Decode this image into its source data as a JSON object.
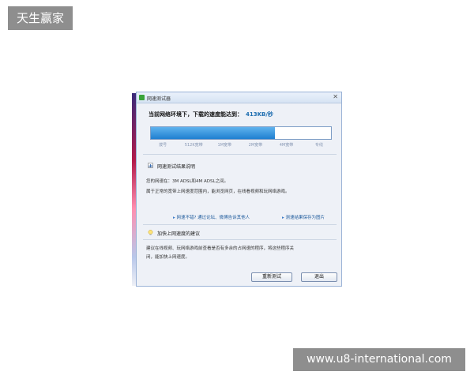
{
  "watermarks": {
    "top_left": "天生赢家",
    "bottom_right": "www.u8-international.com"
  },
  "dialog": {
    "title": "网速测试器",
    "close_glyph": "✕",
    "speed_label": "当前网络环境下，下载的速度能达到：",
    "speed_value": "413KB/秒",
    "progress": 0.69,
    "scale_labels": [
      "拨号",
      "512K宽带",
      "1M宽带",
      "2M宽带",
      "4M宽带",
      "专线"
    ],
    "result_section": {
      "title": "网速测试结果说明",
      "line1": "您的网速在：3M ADSL和4M ADSL之间。",
      "line2": "属于正常的宽带上网速度范围内，能浏览网页，在线看视频和玩网络游戏。"
    },
    "links": {
      "feedback": "网速不错? 通过论坛、微博告诉其他人",
      "save": "测速结果保存为图片"
    },
    "tips_section": {
      "title": "加快上网速度的建议",
      "line1": "建议在线视频、玩网络游戏前查看是否有多余的占网速的程序，将这些程序关",
      "line2": "闭，能加快上网速度。"
    },
    "buttons": {
      "retest": "重新测试",
      "exit": "退出"
    }
  }
}
